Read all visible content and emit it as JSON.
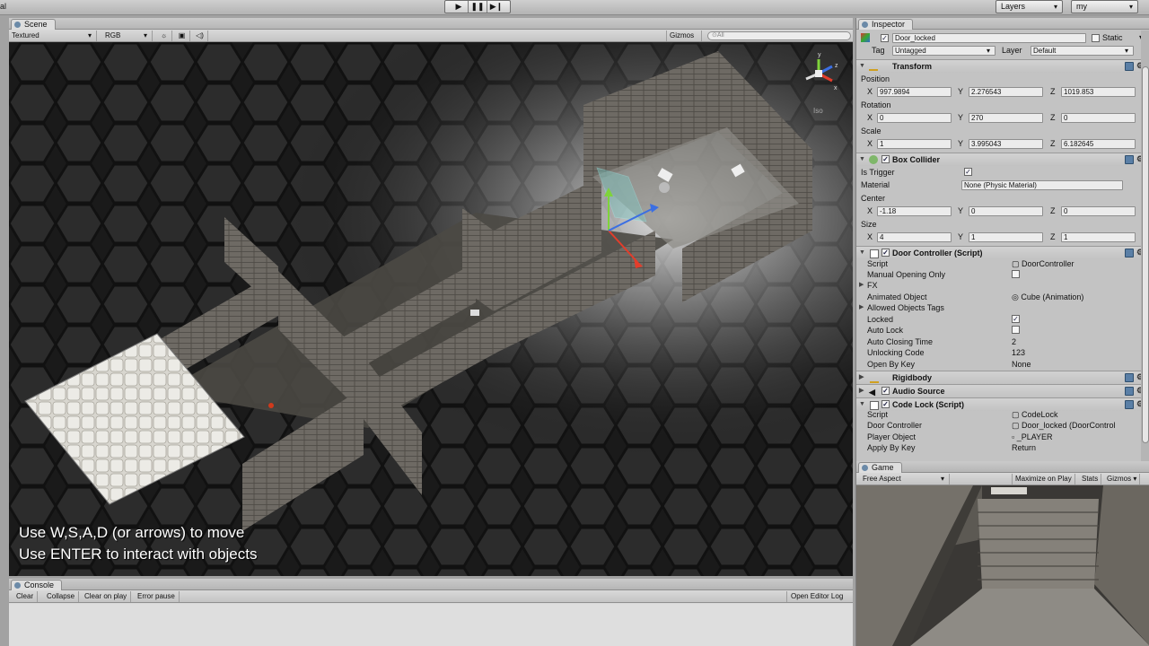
{
  "topbar": {
    "left_clip": "al",
    "play_icon": "play-icon",
    "pause_icon": "pause-icon",
    "step_icon": "step-icon",
    "layers_label": "Layers",
    "layout_label": "my"
  },
  "scene": {
    "tab_label": "Scene",
    "draw_mode": "Textured",
    "render_mode": "RGB",
    "gizmos_label": "Gizmos",
    "search_placeholder": "All",
    "persp_label": "Iso",
    "overlay_line1": "Use W,S,A,D (or arrows) to move",
    "overlay_line2": "Use ENTER to interact with objects"
  },
  "inspector": {
    "tab_label": "Inspector",
    "object_name": "Door_locked",
    "static_label": "Static",
    "tag_label": "Tag",
    "tag_value": "Untagged",
    "layer_label": "Layer",
    "layer_value": "Default",
    "transform": {
      "title": "Transform",
      "position_label": "Position",
      "position": {
        "x": "997.9894",
        "y": "2.276543",
        "z": "1019.853"
      },
      "rotation_label": "Rotation",
      "rotation": {
        "x": "0",
        "y": "270",
        "z": "0"
      },
      "scale_label": "Scale",
      "scale": {
        "x": "1",
        "y": "3.995043",
        "z": "6.182645"
      }
    },
    "box_collider": {
      "title": "Box Collider",
      "is_trigger_label": "Is Trigger",
      "material_label": "Material",
      "material_value": "None (Physic Material)",
      "center_label": "Center",
      "center": {
        "x": "-1.18",
        "y": "0",
        "z": "0"
      },
      "size_label": "Size",
      "size": {
        "x": "4",
        "y": "1",
        "z": "1"
      }
    },
    "door_controller": {
      "title": "Door Controller (Script)",
      "script_label": "Script",
      "script_value": "DoorController",
      "manual_opening_label": "Manual Opening Only",
      "fx_label": "FX",
      "animated_object_label": "Animated Object",
      "animated_object_value": "Cube (Animation)",
      "allowed_tags_label": "Allowed Objects Tags",
      "locked_label": "Locked",
      "auto_lock_label": "Auto Lock",
      "auto_closing_label": "Auto Closing Time",
      "auto_closing_value": "2",
      "unlocking_code_label": "Unlocking Code",
      "unlocking_code_value": "123",
      "open_by_key_label": "Open By Key",
      "open_by_key_value": "None"
    },
    "rigidbody": {
      "title": "Rigidbody"
    },
    "audio_source": {
      "title": "Audio Source"
    },
    "code_lock": {
      "title": "Code Lock (Script)",
      "script_label": "Script",
      "script_value": "CodeLock",
      "door_controller_label": "Door Controller",
      "door_controller_value": "Door_locked (DoorControl",
      "player_object_label": "Player Object",
      "player_object_value": "_PLAYER",
      "apply_by_key_label": "Apply By Key",
      "apply_by_key_value": "Return"
    }
  },
  "game": {
    "tab_label": "Game",
    "aspect": "Free Aspect",
    "maximize_label": "Maximize on Play",
    "stats_label": "Stats",
    "gizmos_label": "Gizmos"
  },
  "console": {
    "tab_label": "Console",
    "clear_label": "Clear",
    "collapse_label": "Collapse",
    "clear_on_play_label": "Clear on play",
    "error_pause_label": "Error pause",
    "open_editor_log_label": "Open Editor Log"
  },
  "colors": {
    "editor_bg": "#c3c3c3",
    "scene_bg": "#1b1b1b",
    "axis_x": "#e33d2b",
    "axis_y": "#7fd33b",
    "axis_z": "#3b6fe3"
  }
}
